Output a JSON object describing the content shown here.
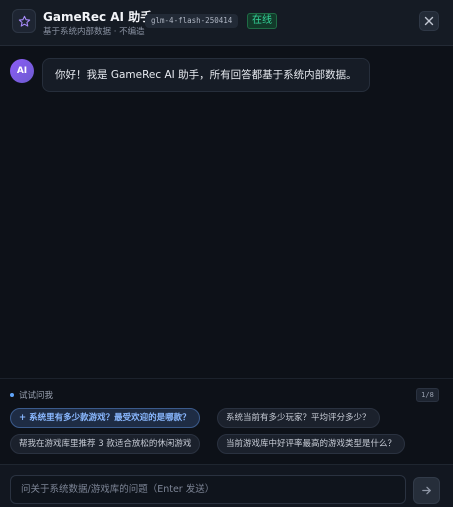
{
  "header": {
    "logo_icon": "star-icon",
    "title": "GameRec AI 助手",
    "subtitle": "基于系统内部数据 · 不编造",
    "model": "glm-4-flash-250414",
    "status": "在线",
    "close_icon": "close-icon"
  },
  "messages": [
    {
      "avatar": "AI",
      "text": "你好！我是 GameRec AI 助手，所有回答都基于系统内部数据。"
    }
  ],
  "suggestions": {
    "label": "试试问我",
    "counter": "1/8",
    "chips": [
      {
        "plus": "+",
        "label": "系统里有多少款游戏？最受欢迎的是哪款？"
      },
      {
        "label": "系统当前有多少玩家？平均评分多少？"
      },
      {
        "label": "帮我在游戏库里推荐 3 款适合放松的休闲游戏"
      },
      {
        "label": "当前游戏库中好评率最高的游戏类型是什么？"
      }
    ]
  },
  "input": {
    "value": "",
    "placeholder": "问关于系统数据/游戏库的问题（Enter 发送）",
    "send_icon": "arrow-right-icon"
  },
  "colors": {
    "background": "#0d1118",
    "accent": "#60a5fa",
    "status": "#34d399",
    "avatar": "#8b5cf6"
  }
}
